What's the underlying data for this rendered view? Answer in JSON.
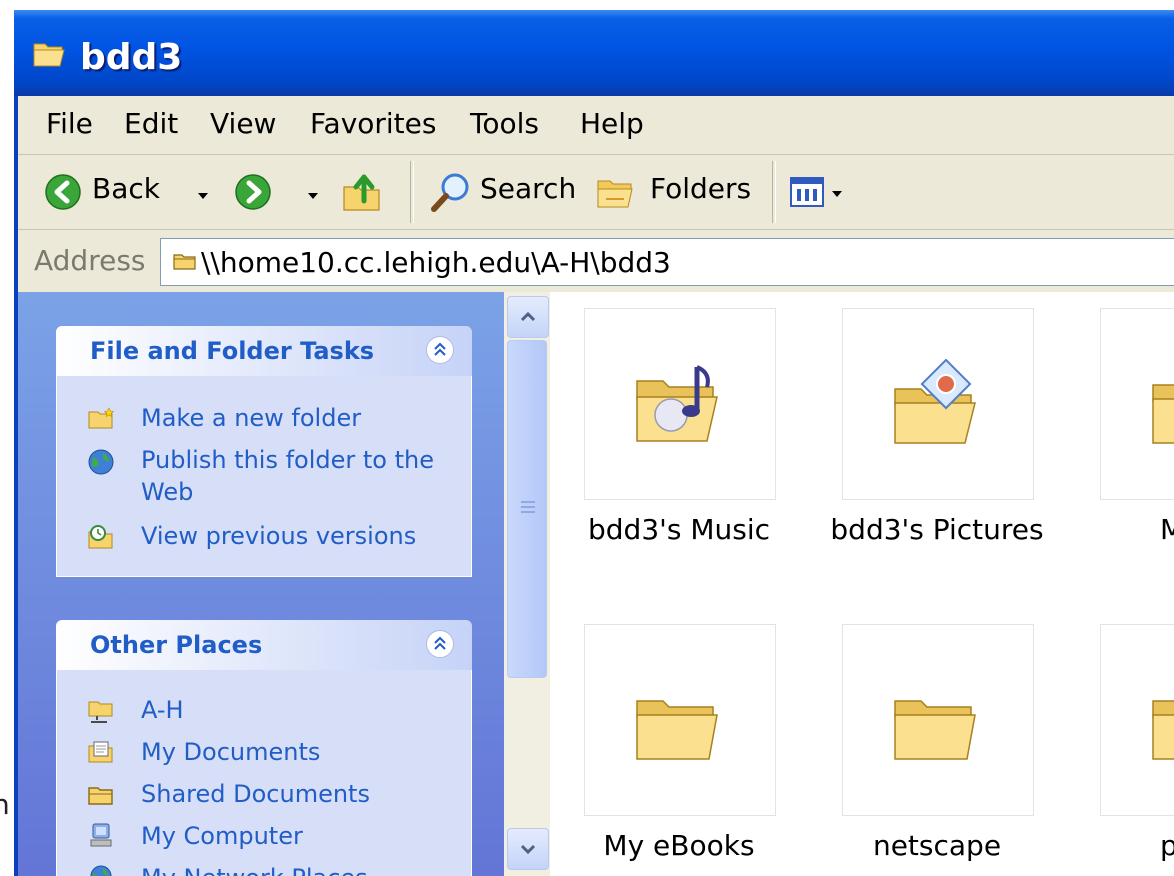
{
  "window": {
    "title": "bdd3"
  },
  "menu": [
    "File",
    "Edit",
    "View",
    "Favorites",
    "Tools",
    "Help"
  ],
  "toolbar": {
    "back_label": "Back",
    "search_label": "Search",
    "folders_label": "Folders"
  },
  "address": {
    "label": "Address",
    "value": "\\\\home10.cc.lehigh.edu\\A-H\\bdd3"
  },
  "tasks_panel": {
    "title": "File and Folder Tasks",
    "items": [
      {
        "label": "Make a new folder",
        "icon": "new-folder-icon"
      },
      {
        "label": "Publish this folder to the Web",
        "icon": "globe-icon"
      },
      {
        "label": "View previous versions",
        "icon": "previous-versions-icon"
      }
    ]
  },
  "places_panel": {
    "title": "Other Places",
    "items": [
      {
        "label": "A-H",
        "icon": "network-folder-icon"
      },
      {
        "label": "My Documents",
        "icon": "my-documents-icon"
      },
      {
        "label": "Shared Documents",
        "icon": "shared-folder-icon"
      },
      {
        "label": "My Computer",
        "icon": "my-computer-icon"
      },
      {
        "label": "My Network Places",
        "icon": "network-places-icon"
      }
    ]
  },
  "files": [
    {
      "name": "bdd3's Music",
      "icon": "music-folder-icon"
    },
    {
      "name": "bdd3's Pictures",
      "icon": "pictures-folder-icon"
    },
    {
      "name": "M",
      "icon": "folder-icon"
    },
    {
      "name": "My eBooks",
      "icon": "folder-icon"
    },
    {
      "name": "netscape",
      "icon": "folder-icon"
    },
    {
      "name": "p",
      "icon": "folder-icon"
    }
  ],
  "desktop_fragment": "n",
  "colors": {
    "title_bar": "#0054e3",
    "task_pane": "#6f8fe0",
    "link_text": "#215dc6",
    "chrome": "#ece9d8"
  }
}
